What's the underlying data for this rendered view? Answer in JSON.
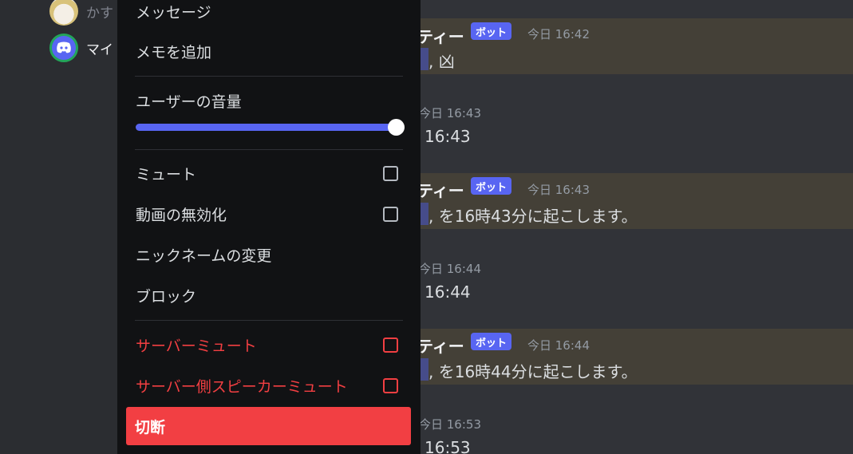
{
  "members": [
    {
      "name": "かす"
    },
    {
      "name": "マイ"
    }
  ],
  "menu": {
    "message": "メッセージ",
    "add_note": "メモを追加",
    "user_volume": "ユーザーの音量",
    "volume_fraction": 1.0,
    "mute": "ミュート",
    "disable_video": "動画の無効化",
    "change_nickname": "ニックネームの変更",
    "block": "ブロック",
    "server_mute": "サーバーミュート",
    "server_deafen": "サーバー側スピーカーミュート",
    "disconnect": "切断"
  },
  "messages": [
    {
      "author": "ティー",
      "tag": "ボット",
      "time": "今日 16:42",
      "body": ", 凶"
    },
    {
      "time": "今日 16:43",
      "body": "16:43"
    },
    {
      "author": "ティー",
      "tag": "ボット",
      "time": "今日 16:43",
      "body": ", を16時43分に起こします。"
    },
    {
      "time": "今日 16:44",
      "body": "16:44"
    },
    {
      "author": "ティー",
      "tag": "ボット",
      "time": "今日 16:44",
      "body": ", を16時44分に起こします。"
    },
    {
      "time": "今日 16:53",
      "body": "16:53"
    }
  ],
  "colors": {
    "accent": "#5865f2",
    "danger": "#f23f42",
    "online": "#23a55a",
    "highlight": "#444037"
  }
}
